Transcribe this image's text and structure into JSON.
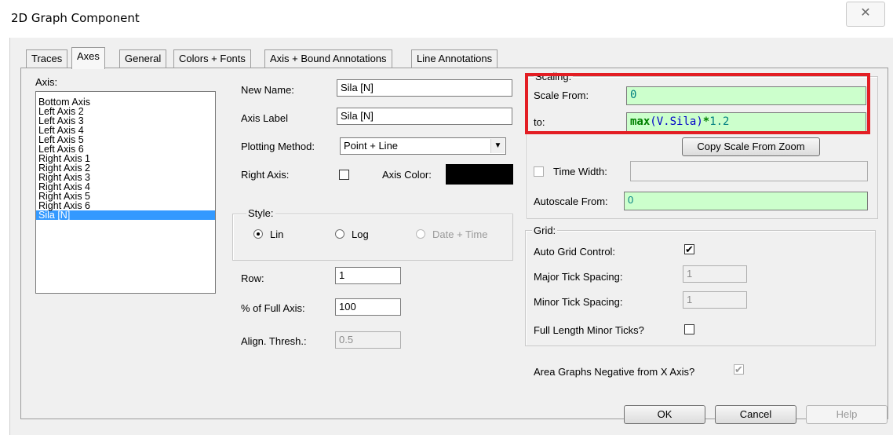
{
  "window": {
    "title": "2D Graph Component",
    "close_glyph": "✕"
  },
  "tabs": [
    "Traces",
    "Axes",
    "General",
    "Colors + Fonts",
    "Axis + Bound Annotations",
    "Line Annotations"
  ],
  "active_tab": "Axes",
  "axis_list": {
    "label": "Axis:",
    "items": [
      "Bottom Axis",
      "Left Axis 2",
      "Left Axis 3",
      "Left Axis 4",
      "Left Axis 5",
      "Left Axis 6",
      "Right Axis 1",
      "Right Axis 2",
      "Right Axis 3",
      "Right Axis 4",
      "Right Axis 5",
      "Right Axis 6",
      "Sila [N]"
    ],
    "selected": "Sila [N]"
  },
  "fields": {
    "new_name": {
      "label": "New Name:",
      "value": "Sila [N]"
    },
    "axis_label": {
      "label": "Axis Label",
      "value": "Sila [N]"
    },
    "plotting_method": {
      "label": "Plotting Method:",
      "value": "Point + Line"
    },
    "right_axis": {
      "label": "Right Axis:",
      "checked": false
    },
    "axis_color": {
      "label": "Axis Color:",
      "color": "#000000"
    },
    "row": {
      "label": "Row:",
      "value": "1"
    },
    "percent_full_axis": {
      "label": "% of Full Axis:",
      "value": "100"
    },
    "align_thresh": {
      "label": "Align. Thresh.:",
      "value": "0.5"
    }
  },
  "style": {
    "legend": "Style:",
    "options": [
      "Lin",
      "Log",
      "Date + Time"
    ],
    "selected": "Lin"
  },
  "scaling": {
    "legend": "Scaling:",
    "scale_from": {
      "label": "Scale From:",
      "value": "0"
    },
    "to": {
      "label": "to:",
      "expr_func": "max",
      "expr_open": "(",
      "expr_var": "V.Sila",
      "expr_close": ")",
      "expr_op": "*",
      "expr_num": "1.2"
    },
    "copy_scale_button": "Copy Scale From Zoom",
    "time_width": {
      "label": "Time Width:",
      "checked": false,
      "value": ""
    },
    "autoscale_from": {
      "label": "Autoscale From:",
      "value": "0"
    }
  },
  "grid": {
    "legend": "Grid:",
    "auto_grid_control": {
      "label": "Auto Grid Control:",
      "checked": true
    },
    "major_tick_spacing": {
      "label": "Major Tick Spacing:",
      "value": "1"
    },
    "minor_tick_spacing": {
      "label": "Minor Tick Spacing:",
      "value": "1"
    },
    "full_length_minor_ticks": {
      "label": "Full Length Minor Ticks?",
      "checked": false
    }
  },
  "area_graphs_negative": {
    "label": "Area Graphs Negative from X Axis?",
    "checked": true
  },
  "buttons": {
    "ok": "OK",
    "cancel": "Cancel",
    "help": "Help"
  },
  "colors": {
    "highlight_box": "#e31e24",
    "selection": "#3399ff",
    "green_field": "#ccffcc"
  }
}
